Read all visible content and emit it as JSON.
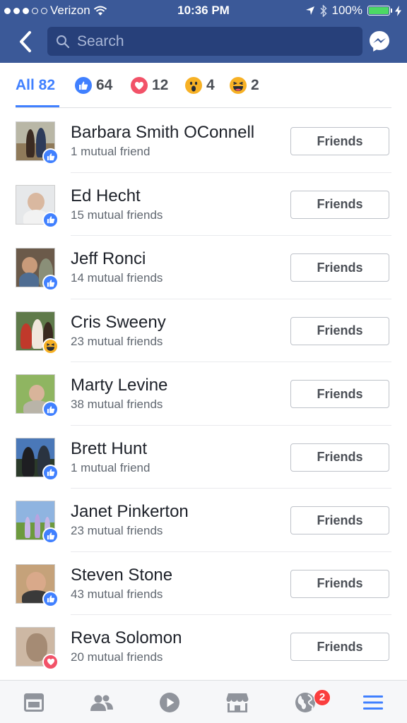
{
  "status_bar": {
    "carrier": "Verizon",
    "time": "10:36 PM",
    "battery": "100%",
    "battery_level": 1.0
  },
  "header": {
    "search_placeholder": "Search"
  },
  "tabs": [
    {
      "label": "All 82",
      "type": "all",
      "selected": true
    },
    {
      "label": "64",
      "type": "like"
    },
    {
      "label": "12",
      "type": "love"
    },
    {
      "label": "4",
      "type": "wow"
    },
    {
      "label": "2",
      "type": "haha"
    }
  ],
  "people": [
    {
      "name": "Barbara Smith OConnell",
      "mutual": "1 mutual friend",
      "reaction": "like",
      "button": "Friends"
    },
    {
      "name": "Ed Hecht",
      "mutual": "15 mutual friends",
      "reaction": "like",
      "button": "Friends"
    },
    {
      "name": "Jeff Ronci",
      "mutual": "14 mutual friends",
      "reaction": "like",
      "button": "Friends"
    },
    {
      "name": "Cris Sweeny",
      "mutual": "23 mutual friends",
      "reaction": "haha",
      "button": "Friends"
    },
    {
      "name": "Marty Levine",
      "mutual": "38 mutual friends",
      "reaction": "like",
      "button": "Friends"
    },
    {
      "name": "Brett Hunt",
      "mutual": "1 mutual friend",
      "reaction": "like",
      "button": "Friends"
    },
    {
      "name": "Janet Pinkerton",
      "mutual": "23 mutual friends",
      "reaction": "like",
      "button": "Friends"
    },
    {
      "name": "Steven Stone",
      "mutual": "43 mutual friends",
      "reaction": "like",
      "button": "Friends"
    },
    {
      "name": "Reva Solomon",
      "mutual": "20 mutual friends",
      "reaction": "love",
      "button": "Friends"
    }
  ],
  "bottom_nav": {
    "notifications_badge": "2",
    "items": [
      "news-feed-icon",
      "friends-icon",
      "video-icon",
      "marketplace-icon",
      "notifications-globe-icon",
      "menu-icon"
    ]
  },
  "colors": {
    "header_bg": "#3b5998",
    "accent": "#4080ff",
    "like": "#4080ff",
    "love": "#f25268",
    "wow_haha": "#f7b125",
    "badge_red": "#fa3e3e"
  }
}
